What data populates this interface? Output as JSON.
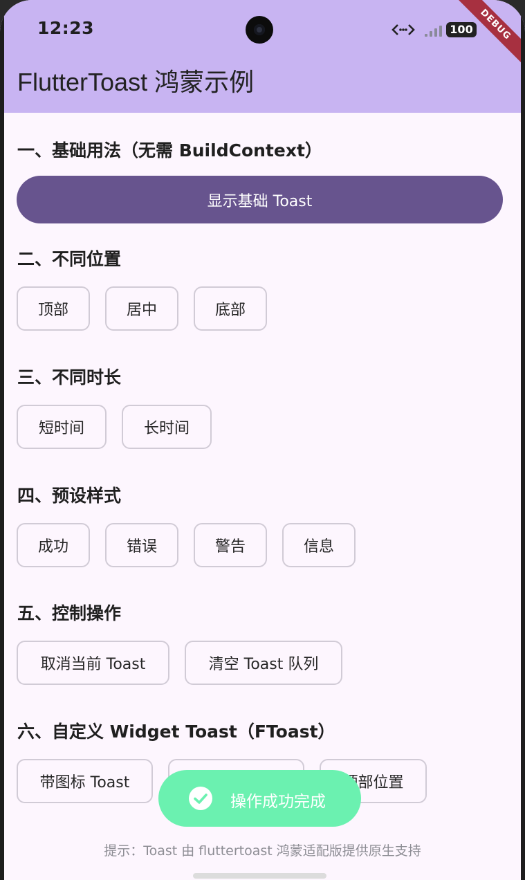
{
  "status": {
    "time": "12:23",
    "battery": "100",
    "link_icon": "link-icon",
    "signal_icon": "signal-icon"
  },
  "debug_label": "DEBUG",
  "app_title": "FlutterToast 鸿蒙示例",
  "sections": {
    "basic": {
      "title": "一、基础用法（无需 BuildContext）",
      "button": "显示基础 Toast"
    },
    "position": {
      "title": "二、不同位置",
      "buttons": [
        "顶部",
        "居中",
        "底部"
      ]
    },
    "duration": {
      "title": "三、不同时长",
      "buttons": [
        "短时间",
        "长时间"
      ]
    },
    "preset": {
      "title": "四、预设样式",
      "buttons": [
        "成功",
        "错误",
        "警告",
        "信息"
      ]
    },
    "control": {
      "title": "五、控制操作",
      "buttons": [
        "取消当前 Toast",
        "清空 Toast 队列"
      ]
    },
    "custom": {
      "title": "六、自定义 Widget Toast（FToast）",
      "buttons": [
        "带图标 Toast",
        "",
        "顶部位置"
      ]
    }
  },
  "toast": {
    "text": "操作成功完成",
    "icon": "check-circle-icon"
  },
  "hint": "提示：Toast 由 fluttertoast 鸿蒙适配版提供原生支持",
  "colors": {
    "appbar": "#c8b4f2",
    "primary_button": "#67548e",
    "toast": "#6bf1b0",
    "background": "#fdf6fe"
  }
}
